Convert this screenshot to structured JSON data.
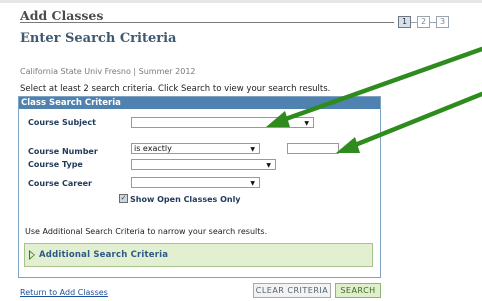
{
  "header": {
    "title": "Add Classes",
    "subtitle": "Enter Search Criteria",
    "steps": [
      "1",
      "2",
      "3"
    ],
    "active_step": 1
  },
  "context": "California State Univ  Fresno | Summer 2012",
  "instructions": "Select at least 2 search criteria. Click Search to view your search results.",
  "panel": {
    "title": "Class Search Criteria",
    "course_subject": {
      "label": "Course Subject",
      "value": ""
    },
    "course_number": {
      "label": "Course Number",
      "operator": "is exactly",
      "value": ""
    },
    "course_type": {
      "label": "Course Type",
      "value": ""
    },
    "course_career": {
      "label": "Course Career",
      "value": ""
    },
    "open_only": {
      "label": "Show Open Classes Only",
      "checked": true
    },
    "help": "Use Additional Search Criteria to narrow your search results.",
    "additional_label": "Additional Search Criteria"
  },
  "footer": {
    "return_link": "Return to Add Classes",
    "clear_button": "CLEAR CRITERIA",
    "search_button": "SEARCH"
  },
  "colors": {
    "panel_header": "#4f81b1",
    "additional_bg": "#e2efd0",
    "annotation_arrow": "#2e8b1e"
  }
}
